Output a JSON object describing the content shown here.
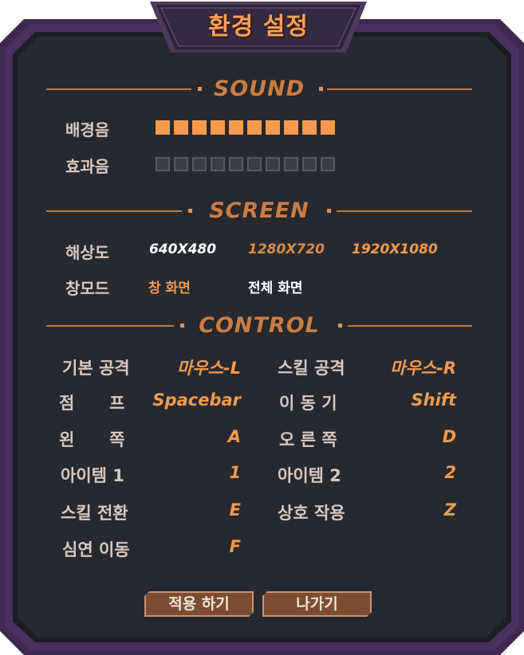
{
  "title": "환경 설정",
  "colors": {
    "accent": "#f59a4e",
    "panel": "#23272c",
    "frame": "#3f2950",
    "frame_dark": "#251833",
    "text": "#d8c8c0",
    "white": "#ffffff"
  },
  "sound": {
    "heading": "SOUND",
    "bgm_label": "배경음",
    "bgm_level": 10,
    "sfx_label": "효과음",
    "sfx_level": 0,
    "max_level": 10
  },
  "screen": {
    "heading": "SCREEN",
    "resolution_label": "해상도",
    "resolutions": [
      "640X480",
      "1280X720",
      "1920X1080"
    ],
    "selected_resolution": "640X480",
    "window_mode_label": "창모드",
    "window_modes": [
      "창 화면",
      "전체 화면"
    ],
    "selected_mode": "창 화면"
  },
  "control": {
    "heading": "CONTROL",
    "left": [
      {
        "label": "기본 공격",
        "key": "마우스-L"
      },
      {
        "label": "점      프",
        "key": "Spacebar"
      },
      {
        "label": "왼      쪽",
        "key": "A"
      },
      {
        "label": "아이템 1",
        "key": "1"
      },
      {
        "label": "스킬 전환",
        "key": "E"
      },
      {
        "label": "심연 이동",
        "key": "F"
      }
    ],
    "right": [
      {
        "label": "스킬 공격",
        "key": "마우스-R"
      },
      {
        "label": "이 동 기",
        "key": "Shift"
      },
      {
        "label": "오 른 쪽",
        "key": "D"
      },
      {
        "label": "아이템 2",
        "key": "2"
      },
      {
        "label": "상호 작용",
        "key": "Z"
      }
    ]
  },
  "buttons": {
    "apply": "적용 하기",
    "exit": "나가기"
  }
}
